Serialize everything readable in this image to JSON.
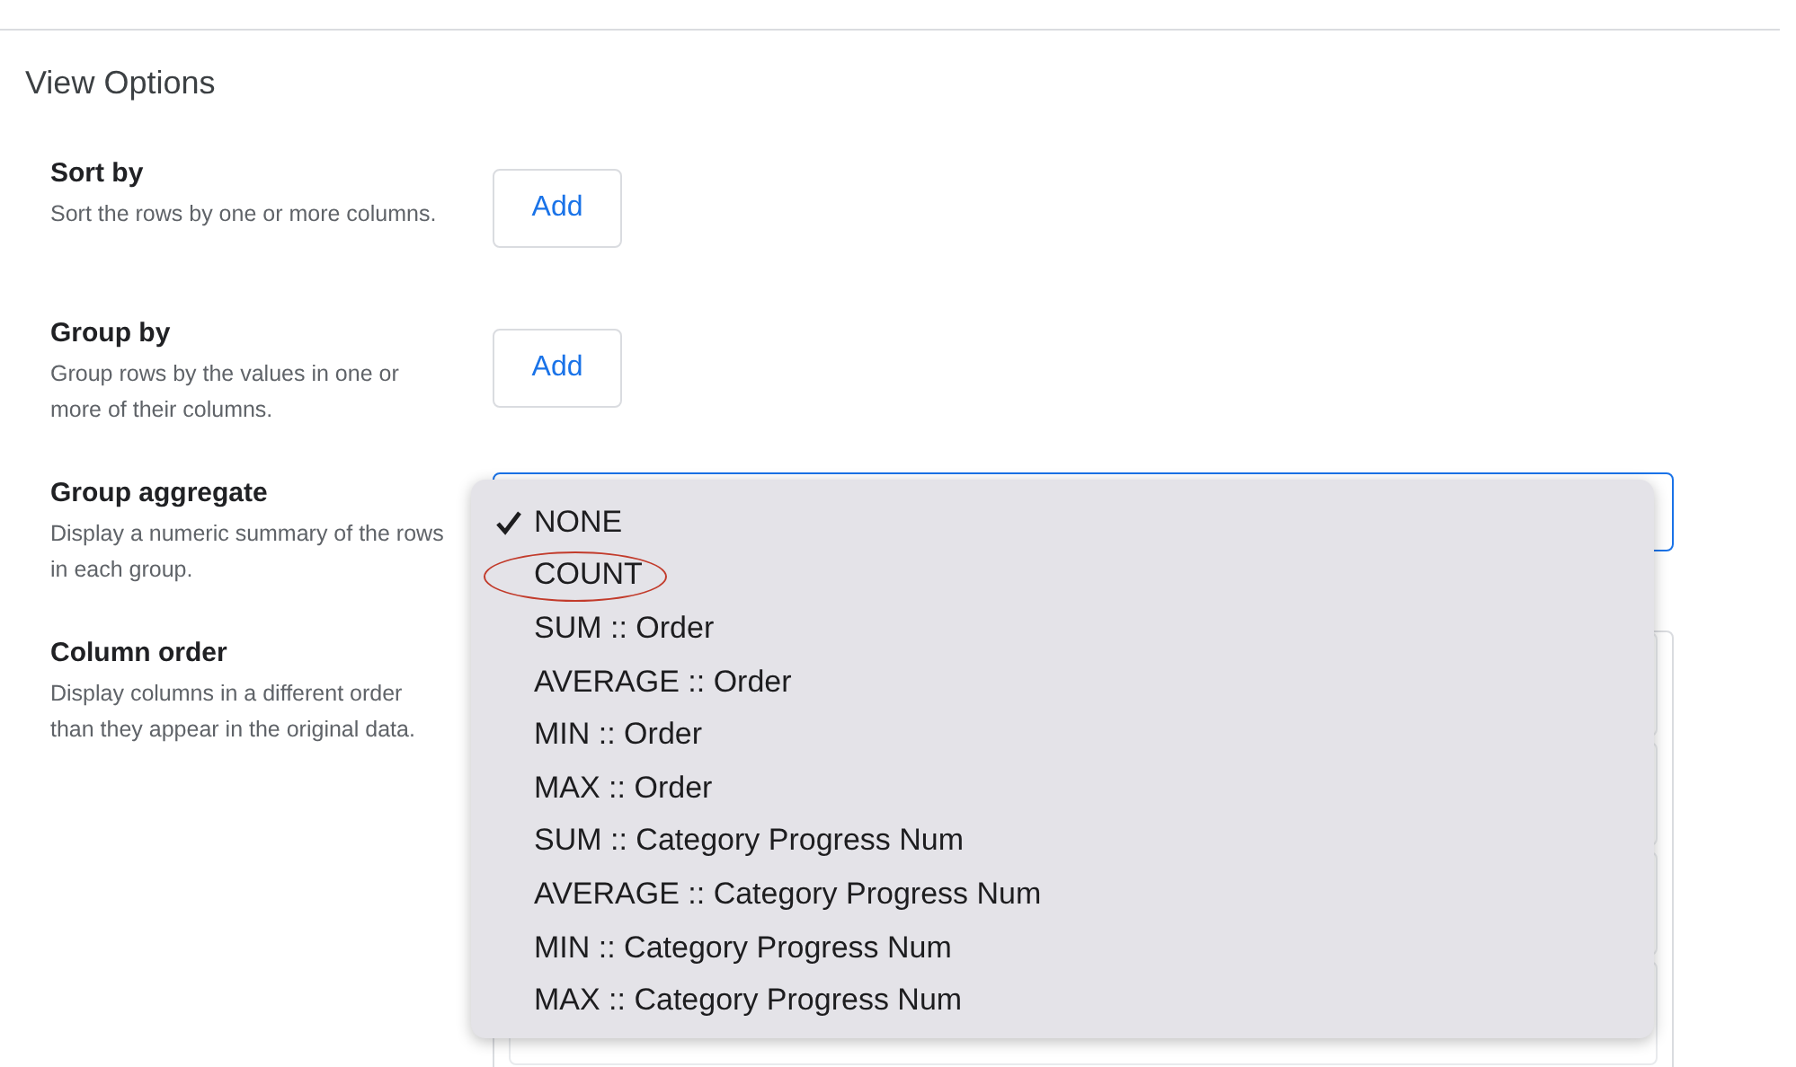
{
  "title": "View Options",
  "sections": [
    {
      "title": "Sort by",
      "description": "Sort the rows by one or more columns.",
      "kind": "button",
      "button": "Add"
    },
    {
      "title": "Group by",
      "description": "Group rows by the values in one or more of their columns.",
      "kind": "button",
      "button": "Add"
    },
    {
      "title": "Group aggregate",
      "description": "Display a numeric summary of the rows in each group.",
      "kind": "select"
    },
    {
      "title": "Column order",
      "description": "Display columns in a different order than they appear in the original data.",
      "kind": "list"
    }
  ],
  "dropdown": {
    "options": [
      {
        "label": "NONE",
        "selected": true,
        "circled": false
      },
      {
        "label": "COUNT",
        "selected": false,
        "circled": true
      },
      {
        "label": "SUM :: Order",
        "selected": false,
        "circled": false
      },
      {
        "label": "AVERAGE :: Order",
        "selected": false,
        "circled": false
      },
      {
        "label": "MIN :: Order",
        "selected": false,
        "circled": false
      },
      {
        "label": "MAX :: Order",
        "selected": false,
        "circled": false
      },
      {
        "label": "SUM :: Category Progress Num",
        "selected": false,
        "circled": false
      },
      {
        "label": "AVERAGE :: Category Progress Num",
        "selected": false,
        "circled": false
      },
      {
        "label": "MIN :: Category Progress Num",
        "selected": false,
        "circled": false
      },
      {
        "label": "MAX :: Category Progress Num",
        "selected": false,
        "circled": false
      }
    ]
  }
}
